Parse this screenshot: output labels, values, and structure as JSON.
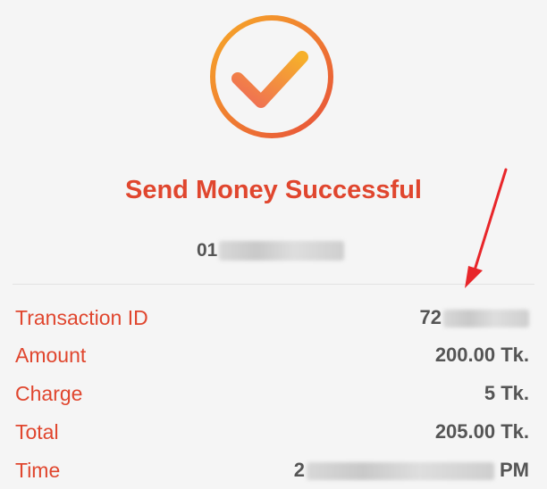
{
  "header": {
    "status_icon": "check-circle-icon",
    "title": "Send Money Successful",
    "recipient_prefix": "01"
  },
  "details": [
    {
      "label": "Transaction ID",
      "value": "72"
    },
    {
      "label": "Amount",
      "value": "200.00 Tk."
    },
    {
      "label": "Charge",
      "value": "5 Tk."
    },
    {
      "label": "Total",
      "value": "205.00 Tk."
    },
    {
      "label": "Time",
      "value_prefix": "2",
      "value_suffix": "PM"
    }
  ],
  "colors": {
    "accent": "#e0462e",
    "ring_start": "#f5a623",
    "ring_end": "#e8553a",
    "annotation_arrow": "#e8262a"
  }
}
